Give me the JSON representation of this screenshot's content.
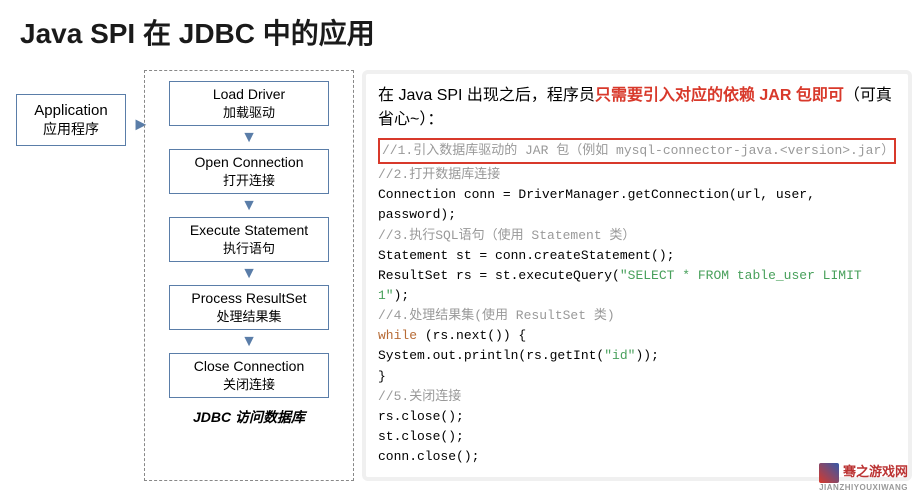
{
  "title": "Java SPI 在 JDBC 中的应用",
  "app": {
    "en": "Application",
    "cn": "应用程序"
  },
  "steps": [
    {
      "en": "Load Driver",
      "cn": "加载驱动"
    },
    {
      "en": "Open Connection",
      "cn": "打开连接"
    },
    {
      "en": "Execute Statement",
      "cn": "执行语句"
    },
    {
      "en": "Process ResultSet",
      "cn": "处理结果集"
    },
    {
      "en": "Close Connection",
      "cn": "关闭连接"
    }
  ],
  "flow_caption": "JDBC 访问数据库",
  "explain": {
    "prefix": "在 Java SPI 出现之后，程序员",
    "highlight": "只需要引入对应的依赖 JAR 包即可",
    "suffix": "（可真省心~）："
  },
  "code": {
    "l1": "//1.引入数据库驱动的 JAR 包（例如 mysql-connector-java.<version>.jar）",
    "l2": "//2.打开数据库连接",
    "l3a": "Connection conn = DriverManager.getConnection(url, user, password);",
    "l4": "//3.执行SQL语句（使用 Statement 类）",
    "l5": "Statement st = conn.createStatement();",
    "l6a": "ResultSet rs = st.executeQuery(",
    "l6b": "\"SELECT * FROM table_user LIMIT 1\"",
    "l6c": ");",
    "l7": "//4.处理结果集(使用 ResultSet 类)",
    "l8a": "while",
    "l8b": " (rs.next()) {",
    "l9a": "    System.out.println(rs.getInt(",
    "l9b": "\"id\"",
    "l9c": "));",
    "l10": "}",
    "l11": "//5.关闭连接",
    "l12": "rs.close();",
    "l13": "st.close();",
    "l14": "conn.close();"
  },
  "watermark": {
    "text": "骞之游戏网",
    "pinyin": "JIANZHIYOUXIWANG"
  }
}
